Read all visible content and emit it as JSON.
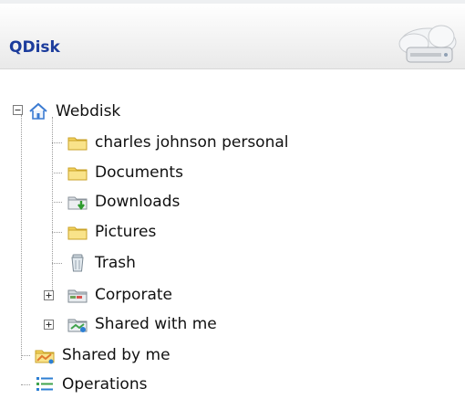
{
  "header": {
    "title": "QDisk",
    "logo_icon": "cloud-disk-icon"
  },
  "tree": {
    "root": {
      "label": "Webdisk",
      "icon": "home-icon",
      "expanded": true
    },
    "children": [
      {
        "label": "charles johnson personal",
        "icon": "folder-icon"
      },
      {
        "label": "Documents",
        "icon": "folder-icon"
      },
      {
        "label": "Downloads",
        "icon": "download-folder-icon"
      },
      {
        "label": "Pictures",
        "icon": "folder-icon"
      },
      {
        "label": "Trash",
        "icon": "trash-icon"
      },
      {
        "label": "Corporate",
        "icon": "shared-folder-icon",
        "expandable": true
      },
      {
        "label": "Shared with me",
        "icon": "shared-with-me-icon",
        "expandable": true
      }
    ],
    "top_items": [
      {
        "label": "Shared by me",
        "icon": "shared-by-me-icon"
      },
      {
        "label": "Operations",
        "icon": "operations-list-icon"
      }
    ]
  },
  "colors": {
    "title": "#1c3c9c",
    "folder": "#f4d35e",
    "folder_edge": "#c9a227"
  }
}
